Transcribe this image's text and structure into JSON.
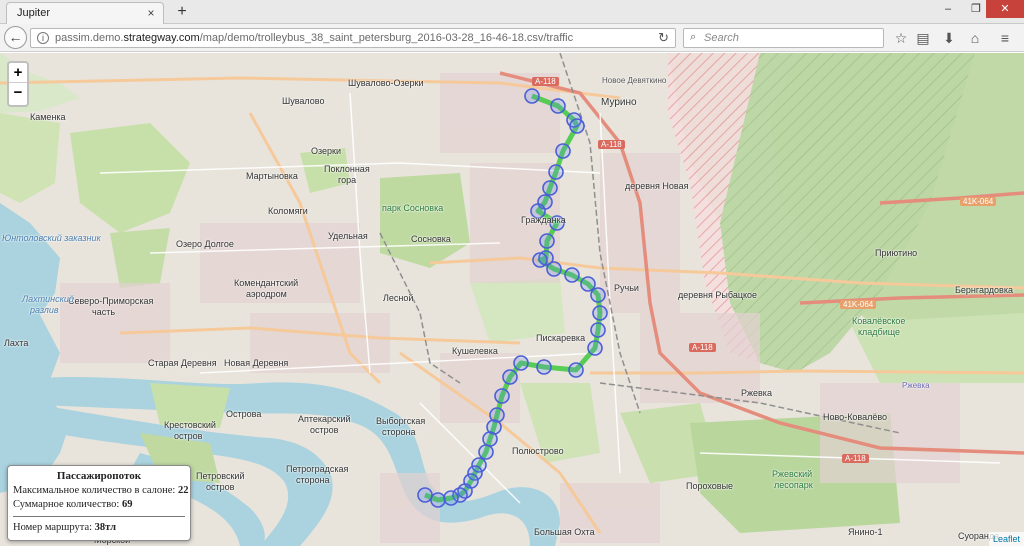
{
  "browser": {
    "tab_title": "Jupiter",
    "tab_close": "×",
    "new_tab": "+",
    "window_controls": {
      "minimize": "–",
      "maximize": "❐",
      "close": "✕"
    },
    "url_prefix": "passim.demo.",
    "url_domain": "strategway.com",
    "url_path": "/map/demo/trolleybus_38_saint_petersburg_2016-03-28_16-46-18.csv/traffic",
    "search_placeholder": "Search",
    "icons": [
      "back-arrow-icon",
      "info-icon",
      "reload-icon",
      "search-icon",
      "bookmark-star-icon",
      "reading-list-icon",
      "download-icon",
      "home-icon",
      "menu-icon"
    ]
  },
  "map": {
    "zoom_in": "+",
    "zoom_out": "−",
    "labels": {
      "shuvalovo_ozerki": "Шувалово-Озерки",
      "shuvalovo": "Шувалово",
      "murino": "Мурино",
      "kamenka": "Каменка",
      "ozerki": "Озерки",
      "poklonnaya_gora_1": "Поклонная",
      "poklonnaya_gora_2": "гора",
      "martynovka": "Мартыновка",
      "kolomyagi": "Коломяги",
      "park_sosnovka": "парк Сосновка",
      "grazhdanka": "Гражданка",
      "derevnya_novaya": "деревня Новая",
      "udelnaya": "Удельная",
      "sosnovka": "Сосновка",
      "ozero_dolgoe": "Озеро Долгое",
      "komendantsky_1": "Комендантский",
      "komendantsky_2": "аэродром",
      "ruchi": "Ручьи",
      "derevnya_rybatskoe": "деревня Рыбацкое",
      "lesnoy": "Лесной",
      "severo_primorskaya_1": "Северо-Приморская",
      "severo_primorskaya_2": "часть",
      "piskarevka": "Пискаревка",
      "kushelevka": "Кушелевка",
      "lakhta": "Лахта",
      "staraya_derevnya": "Старая Деревня",
      "novaya_derevnya": "Новая Деревня",
      "ostrova": "Острова",
      "krestovsky_1": "Крестовский",
      "krestovsky_2": "остров",
      "aptekarsky_1": "Аптекарский",
      "aptekarsky_2": "остров",
      "vyborgskaya_1": "Выборгская",
      "vyborgskaya_2": "сторона",
      "polyustrovo": "Полюстрово",
      "petrovsky_1": "Петровский",
      "petrovsky_2": "остров",
      "petrogradskaya_1": "Петроградская",
      "petrogradskaya_2": "сторона",
      "porokhovye": "Пороховые",
      "bolshaya_okhta": "Большая Охта",
      "morskoy": "Морской",
      "rzhevka": "Ржевка",
      "novo_kovalevo": "Ново-Ковалёво",
      "rzhevsky_1": "Ржевский",
      "rzhevsky_2": "лесопарк",
      "yanino": "Янино-1",
      "kovalevskoe_1": "Ковалёвское",
      "kovalevskoe_2": "кладбище",
      "privetnino": "Приютино",
      "berngardovka": "Бернгардовка",
      "suoranda": "Суоранда",
      "rzhevka_airport": "Ржевка",
      "lakhtinsky_1": "Лахтинский",
      "lakhtinsky_2": "разлив",
      "antolovsky": "Юнтоловский заказник",
      "novoe_devyatkino": "Новое Девяткино"
    },
    "roads": {
      "a118_top": "A-118",
      "a118_mid": "A-118",
      "a118_right": "A-118",
      "a118_low": "A-118",
      "k41_064_a": "41K-064",
      "k41_064_b": "41K-064"
    },
    "route_color": "#3ec93e",
    "stop_color": "#4a5fd6",
    "attribution": "Leaflet"
  },
  "panel": {
    "title": "Пассажиропоток",
    "max_label": "Максимальное количество в салоне:",
    "max_value": "22",
    "total_label": "Суммарное количество:",
    "total_value": "69",
    "route_label": "Номер маршрута:",
    "route_value": "38тл"
  }
}
